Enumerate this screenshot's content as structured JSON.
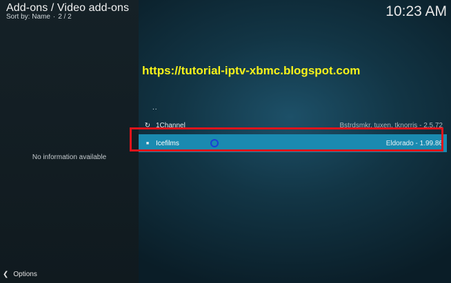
{
  "header": {
    "breadcrumb": "Add-ons / Video add-ons",
    "sort_label": "Sort by: Name",
    "page": "2 / 2",
    "clock": "10:23 AM"
  },
  "info_panel": {
    "message": "No information available"
  },
  "watermark": "https://tutorial-iptv-xbmc.blogspot.com",
  "list": {
    "items": [
      {
        "label": "..",
        "meta": "",
        "icon": "parent-folder"
      },
      {
        "label": "1Channel",
        "meta": "Bstrdsmkr, tuxen, tknorris - 2.5.72",
        "icon": "refresh-icon"
      },
      {
        "label": "Icefilms",
        "meta": "Eldorado - 1.99.86",
        "icon": "square-bullet-icon",
        "selected": true
      }
    ]
  },
  "footer": {
    "options_label": "Options"
  },
  "colors": {
    "selection": "#1a8ab0",
    "highlight_box": "#e0141b",
    "watermark": "#f7f21a"
  }
}
